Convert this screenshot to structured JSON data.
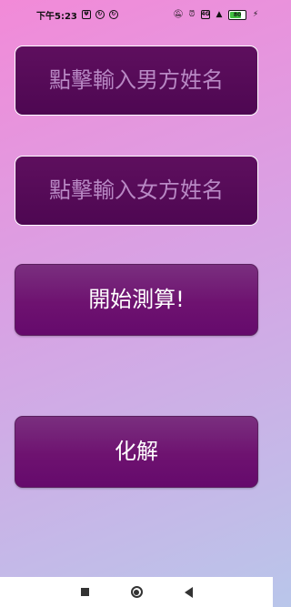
{
  "status_bar": {
    "time": "下午5:23",
    "left_icons": [
      "usb-icon",
      "sync-icon-1",
      "sync-icon-2"
    ],
    "right_icons": [
      "mute-icon",
      "alarm-icon",
      "signal-icon",
      "wifi-icon",
      "battery-icon",
      "charging-icon"
    ],
    "battery_percent": "80"
  },
  "form": {
    "male_name_placeholder": "點擊輸入男方姓名",
    "female_name_placeholder": "點擊輸入女方姓名",
    "start_label": "開始測算!",
    "resolve_label": "化解"
  },
  "nav_bar": {
    "icons": [
      "recent-apps-icon",
      "home-icon",
      "back-icon"
    ]
  },
  "colors": {
    "field_bg": "#560b58",
    "button_bg": "#6e1270",
    "placeholder_text": "#b888c4",
    "button_text": "#ffffff"
  }
}
